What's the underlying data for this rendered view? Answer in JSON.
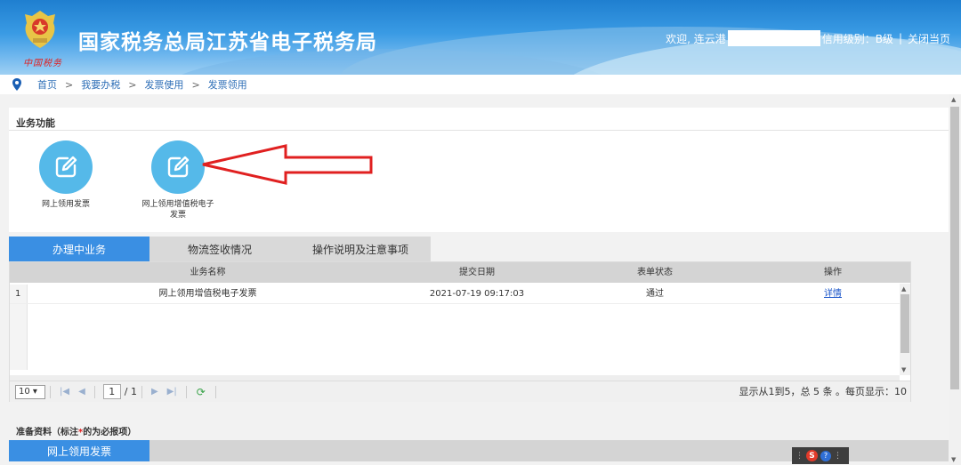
{
  "header": {
    "logo_sub": "中国税务",
    "title": "国家税务总局江苏省电子税务局",
    "welcome": "欢迎, 连云港",
    "credit": "信用级别：B级",
    "close_page": "关闭当页"
  },
  "breadcrumb": {
    "items": [
      "首页",
      "我要办税",
      "发票使用",
      "发票领用"
    ],
    "separator": ">"
  },
  "functions": {
    "title": "业务功能",
    "items": [
      {
        "label": "网上领用发票"
      },
      {
        "label": "网上领用增值税电子发票"
      }
    ]
  },
  "tabs": [
    "办理中业务",
    "物流签收情况",
    "操作说明及注意事项"
  ],
  "grid": {
    "columns": [
      "业务名称",
      "提交日期",
      "表单状态",
      "操作"
    ],
    "rows": [
      {
        "num": "1",
        "name": "网上领用增值税电子发票",
        "date": "2021-07-19 09:17:03",
        "status": "通过",
        "action": "详情"
      }
    ]
  },
  "pager": {
    "page_size": "10",
    "current_page": "1",
    "total_pages": "/ 1",
    "info": "显示从1到5，总 5 条 。每页显示：10"
  },
  "prep": {
    "title_prefix": "准备资料（标注",
    "required_mark": "*",
    "title_suffix": "的为必报项）",
    "tab": "网上领用发票"
  },
  "ime": {
    "s": "S",
    "q": "?"
  },
  "colors": {
    "header_blue": "#2f8bd9",
    "tab_active": "#3a8fe3",
    "icon_circle": "#55b9e9",
    "annotation_red": "#e02020",
    "link": "#1a55c9"
  }
}
